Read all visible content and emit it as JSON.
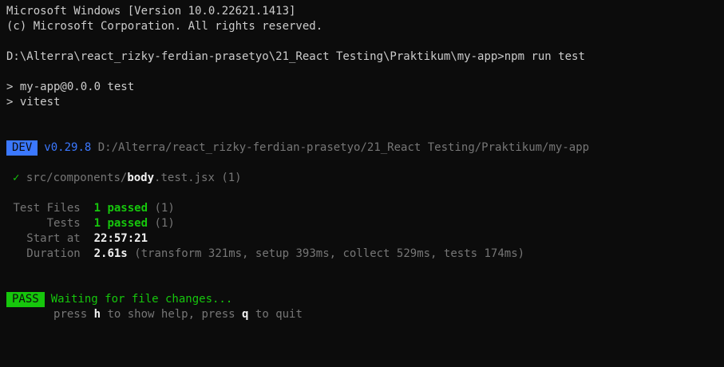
{
  "header": {
    "line1": "Microsoft Windows [Version 10.0.22621.1413]",
    "line2": "(c) Microsoft Corporation. All rights reserved."
  },
  "prompt": {
    "path": "D:\\Alterra\\react_rizky-ferdian-prasetyo\\21_React Testing\\Praktikum\\my-app>",
    "command": "npm run test"
  },
  "script_echo": {
    "line1": "> my-app@0.0.0 test",
    "line2": "> vitest"
  },
  "vitest": {
    "badge": "DEV",
    "version": "v0.29.8",
    "root": "D:/Alterra/react_rizky-ferdian-prasetyo/21_React Testing/Praktikum/my-app",
    "file": {
      "check": "✓",
      "dir": "src/components/",
      "name": "body",
      "ext": ".test.jsx",
      "count": "(1)"
    },
    "summary": {
      "files_label": "Test Files",
      "files_passed": "1 passed",
      "files_count": "(1)",
      "tests_label": "Tests",
      "tests_passed": "1 passed",
      "tests_count": "(1)",
      "start_label": "Start at",
      "start_value": "22:57:21",
      "duration_label": "Duration",
      "duration_value": "2.61s",
      "duration_detail": "(transform 321ms, setup 393ms, collect 529ms, tests 174ms)"
    },
    "status": {
      "badge": "PASS",
      "message": "Waiting for file changes...",
      "help_prefix": "press ",
      "help_key": "h",
      "help_middle": " to show help, press ",
      "quit_key": "q",
      "help_suffix": " to quit"
    }
  }
}
